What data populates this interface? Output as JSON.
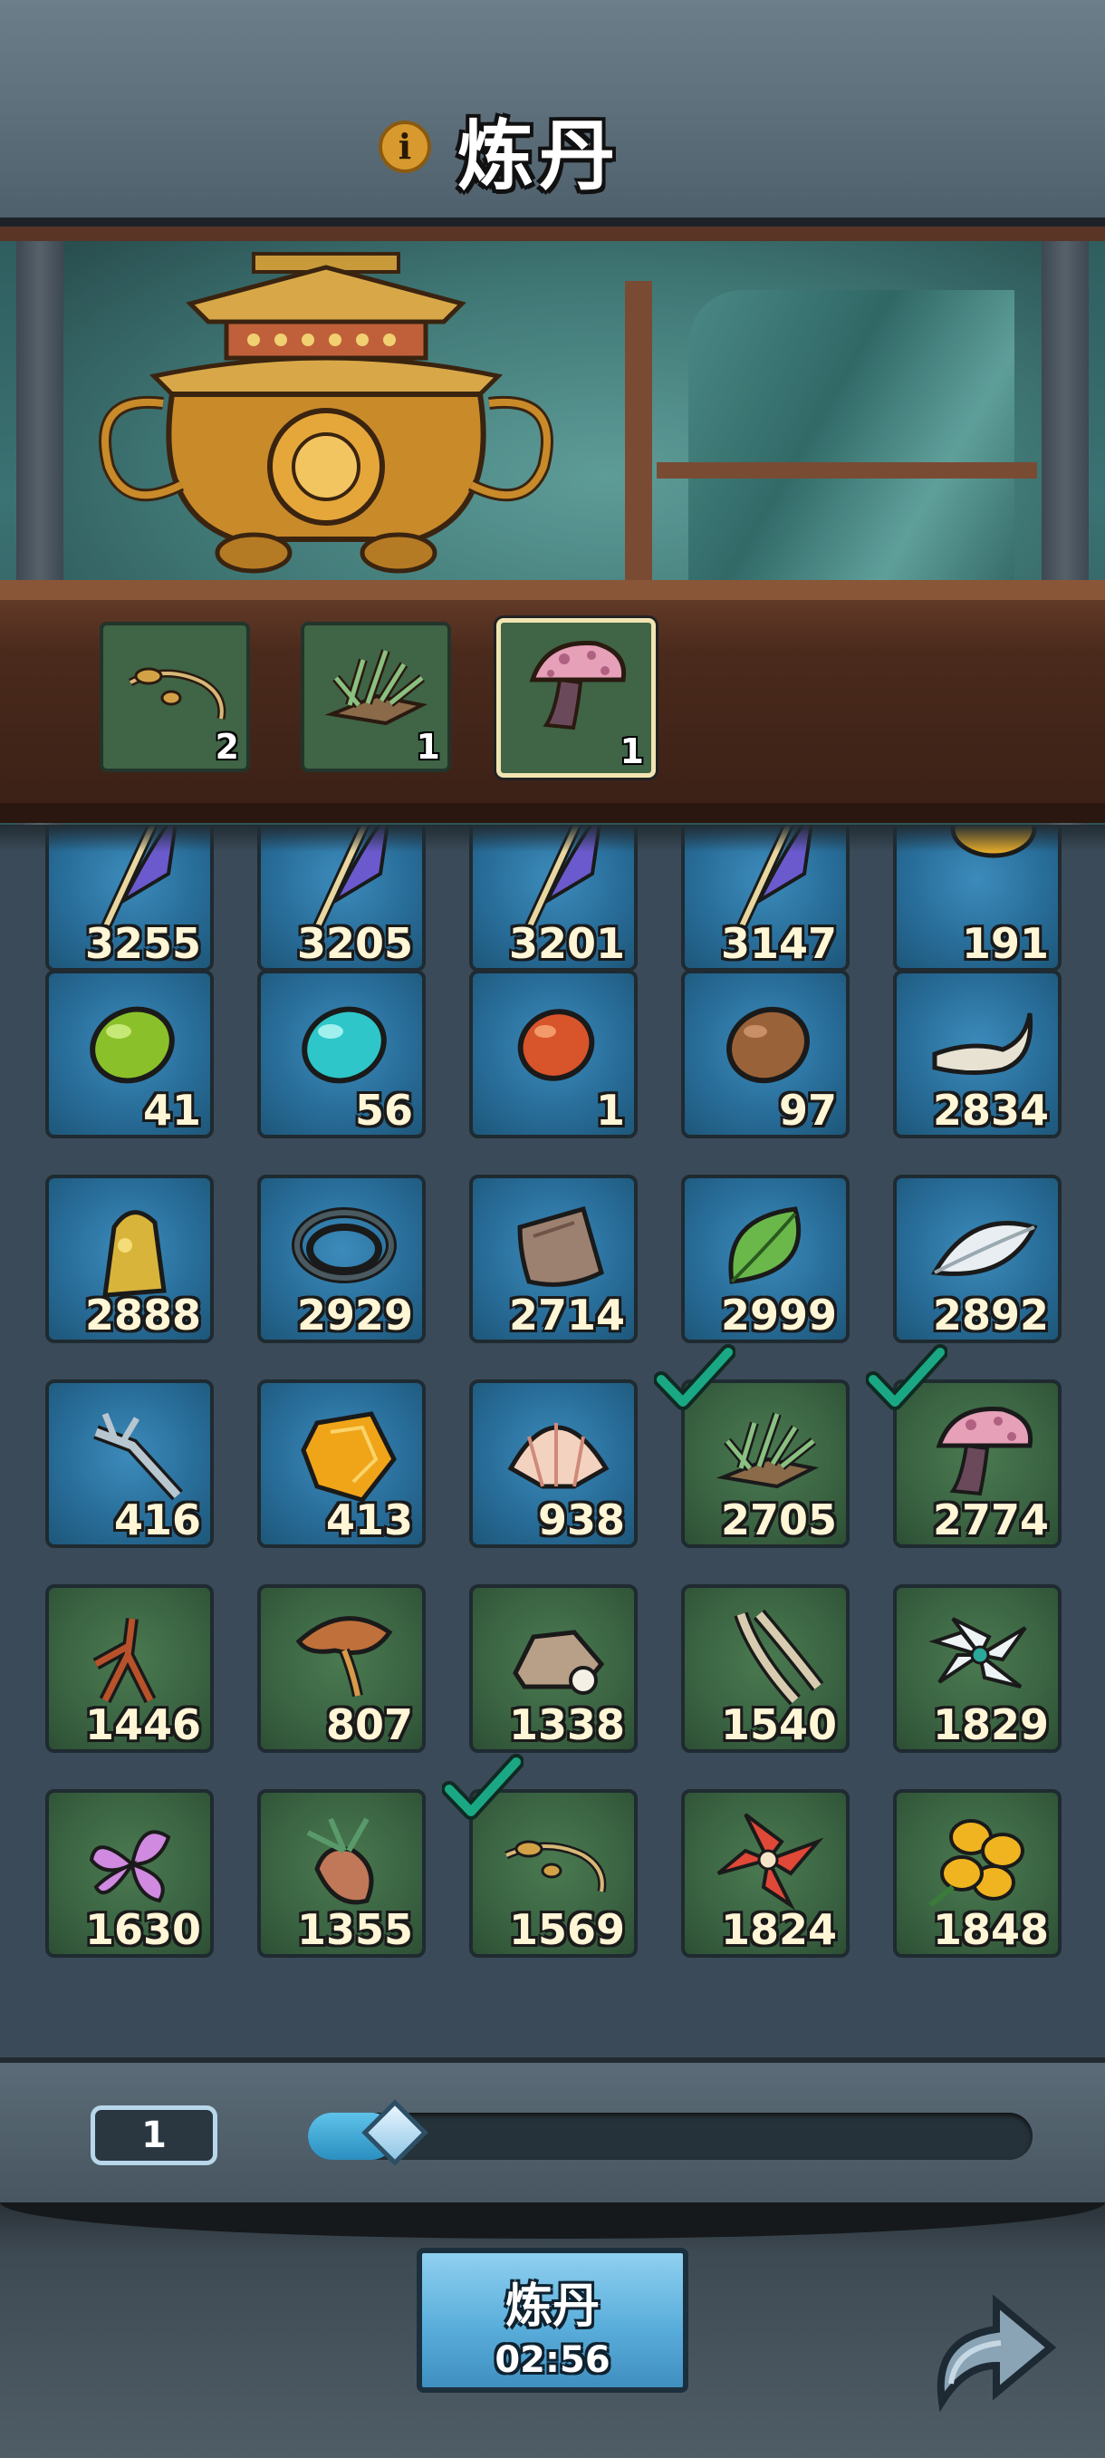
{
  "header": {
    "title": "炼丹",
    "info_icon": "info-icon",
    "info_glyph": "i"
  },
  "furnace": {
    "slots": [
      {
        "icon": "sprout-herb-icon",
        "count": "2",
        "selected": false
      },
      {
        "icon": "grass-herb-icon",
        "count": "1",
        "selected": false
      },
      {
        "icon": "pink-mushroom-icon",
        "count": "1",
        "selected": true
      }
    ]
  },
  "inventory": {
    "rows": [
      [
        {
          "icon": "feather-quill-icon",
          "count": "3255",
          "bg": "blue"
        },
        {
          "icon": "feather-quill-icon",
          "count": "3205",
          "bg": "blue"
        },
        {
          "icon": "feather-quill-icon",
          "count": "3201",
          "bg": "blue"
        },
        {
          "icon": "feather-quill-icon",
          "count": "3147",
          "bg": "blue"
        },
        {
          "icon": "gold-stone-icon",
          "count": "191",
          "bg": "blue"
        }
      ],
      [
        {
          "icon": "green-stone-icon",
          "count": "41",
          "bg": "blue"
        },
        {
          "icon": "cyan-stone-icon",
          "count": "56",
          "bg": "blue"
        },
        {
          "icon": "red-stone-icon",
          "count": "1",
          "bg": "blue"
        },
        {
          "icon": "brown-stone-icon",
          "count": "97",
          "bg": "blue"
        },
        {
          "icon": "horn-icon",
          "count": "2834",
          "bg": "blue"
        }
      ],
      [
        {
          "icon": "gold-ore-icon",
          "count": "2888",
          "bg": "blue"
        },
        {
          "icon": "rope-coil-icon",
          "count": "2929",
          "bg": "blue"
        },
        {
          "icon": "leather-hide-icon",
          "count": "2714",
          "bg": "blue"
        },
        {
          "icon": "green-leaf-icon",
          "count": "2999",
          "bg": "blue"
        },
        {
          "icon": "white-feather-icon",
          "count": "2892",
          "bg": "blue"
        }
      ],
      [
        {
          "icon": "bone-branch-icon",
          "count": "416",
          "bg": "blue"
        },
        {
          "icon": "amber-gem-icon",
          "count": "413",
          "bg": "blue"
        },
        {
          "icon": "seashell-icon",
          "count": "938",
          "bg": "blue"
        },
        {
          "icon": "grass-herb-icon",
          "count": "2705",
          "bg": "green",
          "checked": true
        },
        {
          "icon": "pink-mushroom-icon",
          "count": "2774",
          "bg": "green",
          "checked": true
        }
      ],
      [
        {
          "icon": "ginseng-root-icon",
          "count": "1446",
          "bg": "green"
        },
        {
          "icon": "lingzhi-mushroom-icon",
          "count": "807",
          "bg": "green"
        },
        {
          "icon": "rock-pearl-icon",
          "count": "1338",
          "bg": "green"
        },
        {
          "icon": "pale-roots-icon",
          "count": "1540",
          "bg": "green"
        },
        {
          "icon": "white-lotus-icon",
          "count": "1829",
          "bg": "green"
        }
      ],
      [
        {
          "icon": "purple-flower-icon",
          "count": "1630",
          "bg": "green"
        },
        {
          "icon": "root-bulb-icon",
          "count": "1355",
          "bg": "green"
        },
        {
          "icon": "sprout-herb-icon",
          "count": "1569",
          "bg": "green",
          "checked": true
        },
        {
          "icon": "red-lily-icon",
          "count": "1824",
          "bg": "green"
        },
        {
          "icon": "yellow-flower-icon",
          "count": "1848",
          "bg": "green"
        }
      ]
    ]
  },
  "quantity": {
    "value": "1",
    "slider_fraction": 0.05
  },
  "craft_button": {
    "label": "炼丹",
    "timer": "02:56"
  },
  "share_icon": "share-arrow-icon",
  "colors": {
    "slot_blue": "#276b97",
    "slot_green": "#3a6342",
    "check_green": "#1aa884",
    "button_blue": "#5aaedb"
  }
}
